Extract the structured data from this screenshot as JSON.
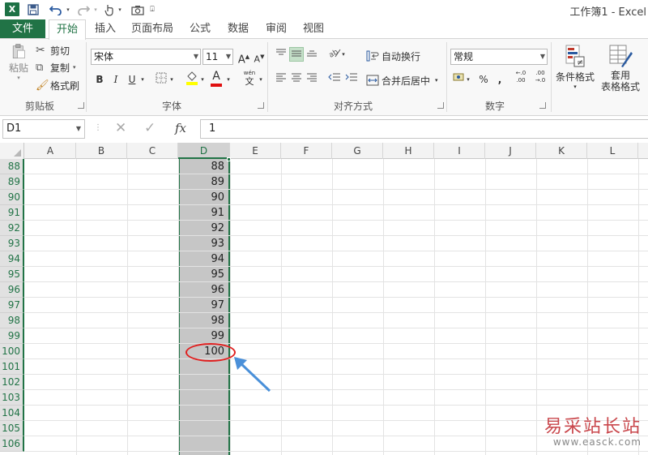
{
  "app": {
    "title": "工作簿1 - Excel",
    "logo": "X",
    "accent": "#217346"
  },
  "quick_access": {
    "save_icon": "save-icon",
    "undo_icon": "undo-icon",
    "redo_icon": "redo-icon",
    "touch_icon": "touch-mode-icon",
    "camera_icon": "camera-icon"
  },
  "tabs": [
    "文件",
    "开始",
    "插入",
    "页面布局",
    "公式",
    "数据",
    "审阅",
    "视图"
  ],
  "active_tab": "开始",
  "ribbon": {
    "clipboard": {
      "paste": "粘贴",
      "cut": "剪切",
      "copy": "复制",
      "format_painter": "格式刷",
      "group": "剪贴板"
    },
    "font": {
      "name": "宋体",
      "size": "11",
      "bold": "B",
      "italic": "I",
      "underline": "U",
      "font_color_letter": "A",
      "phonetic": "wén",
      "group": "字体"
    },
    "alignment": {
      "wrap": "自动换行",
      "merge": "合并后居中",
      "group": "对齐方式"
    },
    "number": {
      "format": "常规",
      "percent": "%",
      "comma": ",",
      "group": "数字"
    },
    "styles": {
      "conditional": "条件格式",
      "table_format_1": "套用",
      "table_format_2": "表格格式"
    }
  },
  "formula_bar": {
    "name_box": "D1",
    "cancel": "✕",
    "enter": "✓",
    "fx": "fx",
    "value": "1"
  },
  "sheet": {
    "columns": [
      "A",
      "B",
      "C",
      "D",
      "E",
      "F",
      "G",
      "H",
      "I",
      "J",
      "K",
      "L"
    ],
    "selected_column": "D",
    "rows": [
      {
        "row": "88",
        "d": "88"
      },
      {
        "row": "89",
        "d": "89"
      },
      {
        "row": "90",
        "d": "90"
      },
      {
        "row": "91",
        "d": "91"
      },
      {
        "row": "92",
        "d": "92"
      },
      {
        "row": "93",
        "d": "93"
      },
      {
        "row": "94",
        "d": "94"
      },
      {
        "row": "95",
        "d": "95"
      },
      {
        "row": "96",
        "d": "96"
      },
      {
        "row": "97",
        "d": "97"
      },
      {
        "row": "98",
        "d": "98"
      },
      {
        "row": "99",
        "d": "99"
      },
      {
        "row": "100",
        "d": "100"
      },
      {
        "row": "101",
        "d": ""
      },
      {
        "row": "102",
        "d": ""
      },
      {
        "row": "103",
        "d": ""
      },
      {
        "row": "104",
        "d": ""
      },
      {
        "row": "105",
        "d": ""
      },
      {
        "row": "106",
        "d": ""
      }
    ],
    "selection_fill": "#c6c6c6"
  },
  "annotation": {
    "highlight_color": "#e02020",
    "arrow_color": "#4a90d9"
  },
  "watermark": {
    "text": "易采站长站",
    "url": "www.easck.com"
  }
}
